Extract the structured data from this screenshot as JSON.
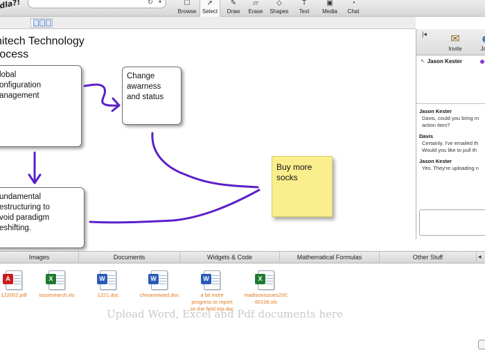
{
  "app": {
    "logo_text": "dla?!"
  },
  "toolbar": {
    "tools": [
      {
        "name": "browse",
        "label": "Browse",
        "icon": "browse-icon"
      },
      {
        "name": "select",
        "label": "Select",
        "icon": "arrow-cursor-icon",
        "active": true
      },
      {
        "name": "draw",
        "label": "Draw",
        "icon": "pencil-icon"
      },
      {
        "name": "erase",
        "label": "Erase",
        "icon": "eraser-icon"
      },
      {
        "name": "shapes",
        "label": "Shapes",
        "icon": "shapes-icon"
      },
      {
        "name": "text",
        "label": "Text",
        "icon": "text-icon"
      },
      {
        "name": "media",
        "label": "Media",
        "icon": "media-icon"
      },
      {
        "name": "chat",
        "label": "Chat",
        "icon": "chat-icon"
      }
    ]
  },
  "canvas": {
    "title": "nitech Technology\nrocess",
    "boxes": {
      "global": "lobal\nonfiguration\nanagement",
      "change": "Change\nawarness\nand status",
      "fundamental": "undamental\nestructuring to\nvoid paradigm\neshifting."
    },
    "sticky_note": "Buy more\nsocks",
    "colors": {
      "ink": "#5b1fc8",
      "sticky": "#fbee8d"
    }
  },
  "side_panel": {
    "invite_label": "Invite",
    "join_label": "Join",
    "users": [
      "Jason Kester"
    ],
    "chat": [
      {
        "author": "Jason Kester",
        "text": "Davis, could you bring m\naction item?"
      },
      {
        "author": "Davis",
        "text": "Certainly. I've emailed th\nWould you like to pull th"
      },
      {
        "author": "Jason Kester",
        "text": "Yes. They're uploading n"
      }
    ]
  },
  "bottom_tabs": [
    "Images",
    "Documents",
    "Widgets & Code",
    "Mathematical Formulas",
    "Other Stuff"
  ],
  "files": [
    {
      "name": "122002.pdf",
      "type": "pdf"
    },
    {
      "name": "issuesearch.xls",
      "type": "xls"
    },
    {
      "name": "1221.doc",
      "type": "doc"
    },
    {
      "name": "chinaonward.doc",
      "type": "doc"
    },
    {
      "name": "a bit more\nprogress to report\non the field trip.doc",
      "type": "doc"
    },
    {
      "name": "madisonissues20C\n60106.xls",
      "type": "xls"
    }
  ],
  "upload_hint": "Upload Word, Excel and Pdf documents here"
}
